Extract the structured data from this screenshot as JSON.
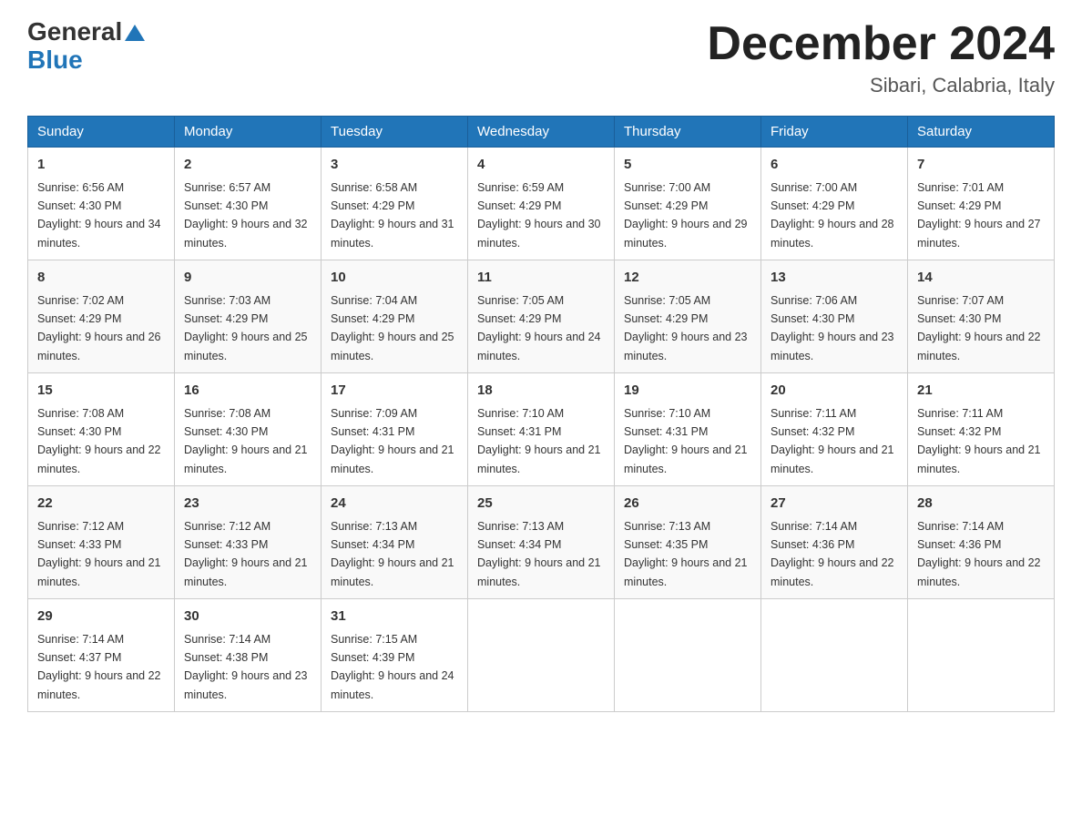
{
  "header": {
    "logo_general": "General",
    "logo_blue": "Blue",
    "month_title": "December 2024",
    "location": "Sibari, Calabria, Italy"
  },
  "weekdays": [
    "Sunday",
    "Monday",
    "Tuesday",
    "Wednesday",
    "Thursday",
    "Friday",
    "Saturday"
  ],
  "weeks": [
    [
      {
        "day": "1",
        "sunrise": "6:56 AM",
        "sunset": "4:30 PM",
        "daylight": "9 hours and 34 minutes."
      },
      {
        "day": "2",
        "sunrise": "6:57 AM",
        "sunset": "4:30 PM",
        "daylight": "9 hours and 32 minutes."
      },
      {
        "day": "3",
        "sunrise": "6:58 AM",
        "sunset": "4:29 PM",
        "daylight": "9 hours and 31 minutes."
      },
      {
        "day": "4",
        "sunrise": "6:59 AM",
        "sunset": "4:29 PM",
        "daylight": "9 hours and 30 minutes."
      },
      {
        "day": "5",
        "sunrise": "7:00 AM",
        "sunset": "4:29 PM",
        "daylight": "9 hours and 29 minutes."
      },
      {
        "day": "6",
        "sunrise": "7:00 AM",
        "sunset": "4:29 PM",
        "daylight": "9 hours and 28 minutes."
      },
      {
        "day": "7",
        "sunrise": "7:01 AM",
        "sunset": "4:29 PM",
        "daylight": "9 hours and 27 minutes."
      }
    ],
    [
      {
        "day": "8",
        "sunrise": "7:02 AM",
        "sunset": "4:29 PM",
        "daylight": "9 hours and 26 minutes."
      },
      {
        "day": "9",
        "sunrise": "7:03 AM",
        "sunset": "4:29 PM",
        "daylight": "9 hours and 25 minutes."
      },
      {
        "day": "10",
        "sunrise": "7:04 AM",
        "sunset": "4:29 PM",
        "daylight": "9 hours and 25 minutes."
      },
      {
        "day": "11",
        "sunrise": "7:05 AM",
        "sunset": "4:29 PM",
        "daylight": "9 hours and 24 minutes."
      },
      {
        "day": "12",
        "sunrise": "7:05 AM",
        "sunset": "4:29 PM",
        "daylight": "9 hours and 23 minutes."
      },
      {
        "day": "13",
        "sunrise": "7:06 AM",
        "sunset": "4:30 PM",
        "daylight": "9 hours and 23 minutes."
      },
      {
        "day": "14",
        "sunrise": "7:07 AM",
        "sunset": "4:30 PM",
        "daylight": "9 hours and 22 minutes."
      }
    ],
    [
      {
        "day": "15",
        "sunrise": "7:08 AM",
        "sunset": "4:30 PM",
        "daylight": "9 hours and 22 minutes."
      },
      {
        "day": "16",
        "sunrise": "7:08 AM",
        "sunset": "4:30 PM",
        "daylight": "9 hours and 21 minutes."
      },
      {
        "day": "17",
        "sunrise": "7:09 AM",
        "sunset": "4:31 PM",
        "daylight": "9 hours and 21 minutes."
      },
      {
        "day": "18",
        "sunrise": "7:10 AM",
        "sunset": "4:31 PM",
        "daylight": "9 hours and 21 minutes."
      },
      {
        "day": "19",
        "sunrise": "7:10 AM",
        "sunset": "4:31 PM",
        "daylight": "9 hours and 21 minutes."
      },
      {
        "day": "20",
        "sunrise": "7:11 AM",
        "sunset": "4:32 PM",
        "daylight": "9 hours and 21 minutes."
      },
      {
        "day": "21",
        "sunrise": "7:11 AM",
        "sunset": "4:32 PM",
        "daylight": "9 hours and 21 minutes."
      }
    ],
    [
      {
        "day": "22",
        "sunrise": "7:12 AM",
        "sunset": "4:33 PM",
        "daylight": "9 hours and 21 minutes."
      },
      {
        "day": "23",
        "sunrise": "7:12 AM",
        "sunset": "4:33 PM",
        "daylight": "9 hours and 21 minutes."
      },
      {
        "day": "24",
        "sunrise": "7:13 AM",
        "sunset": "4:34 PM",
        "daylight": "9 hours and 21 minutes."
      },
      {
        "day": "25",
        "sunrise": "7:13 AM",
        "sunset": "4:34 PM",
        "daylight": "9 hours and 21 minutes."
      },
      {
        "day": "26",
        "sunrise": "7:13 AM",
        "sunset": "4:35 PM",
        "daylight": "9 hours and 21 minutes."
      },
      {
        "day": "27",
        "sunrise": "7:14 AM",
        "sunset": "4:36 PM",
        "daylight": "9 hours and 22 minutes."
      },
      {
        "day": "28",
        "sunrise": "7:14 AM",
        "sunset": "4:36 PM",
        "daylight": "9 hours and 22 minutes."
      }
    ],
    [
      {
        "day": "29",
        "sunrise": "7:14 AM",
        "sunset": "4:37 PM",
        "daylight": "9 hours and 22 minutes."
      },
      {
        "day": "30",
        "sunrise": "7:14 AM",
        "sunset": "4:38 PM",
        "daylight": "9 hours and 23 minutes."
      },
      {
        "day": "31",
        "sunrise": "7:15 AM",
        "sunset": "4:39 PM",
        "daylight": "9 hours and 24 minutes."
      },
      null,
      null,
      null,
      null
    ]
  ]
}
